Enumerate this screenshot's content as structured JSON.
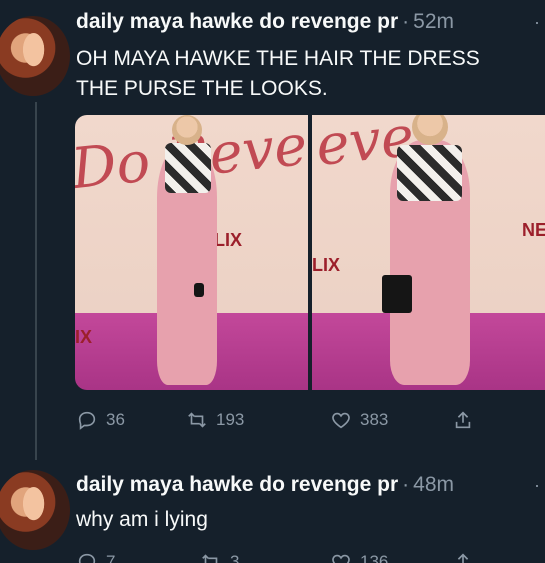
{
  "tweets": [
    {
      "author": "daily maya hawke do revenge pr",
      "separator": "·",
      "time": "52m",
      "text_line1": "OH MAYA HAWKE THE HAIR THE DRESS",
      "text_line2": "THE PURSE THE LOOKS.",
      "media": {
        "left_sign": "Do Reve",
        "left_nf": "FLIX",
        "left_nf2": "IX",
        "right_sign": "eve",
        "right_nf": "LIX",
        "right_nf2": "NE"
      },
      "replies": "36",
      "retweets": "193",
      "likes": "383"
    },
    {
      "author": "daily maya hawke do revenge pr",
      "separator": "·",
      "time": "48m",
      "text": "why am i lying",
      "replies": "7",
      "retweets": "3",
      "likes": "136"
    }
  ],
  "icons": {
    "more": "more-icon",
    "reply": "reply-icon",
    "retweet": "retweet-icon",
    "like": "heart-icon",
    "share": "share-icon"
  },
  "colors": {
    "background": "#15202b",
    "text": "#f7f9f9",
    "muted": "#8b98a5",
    "thread_line": "#38444d"
  }
}
